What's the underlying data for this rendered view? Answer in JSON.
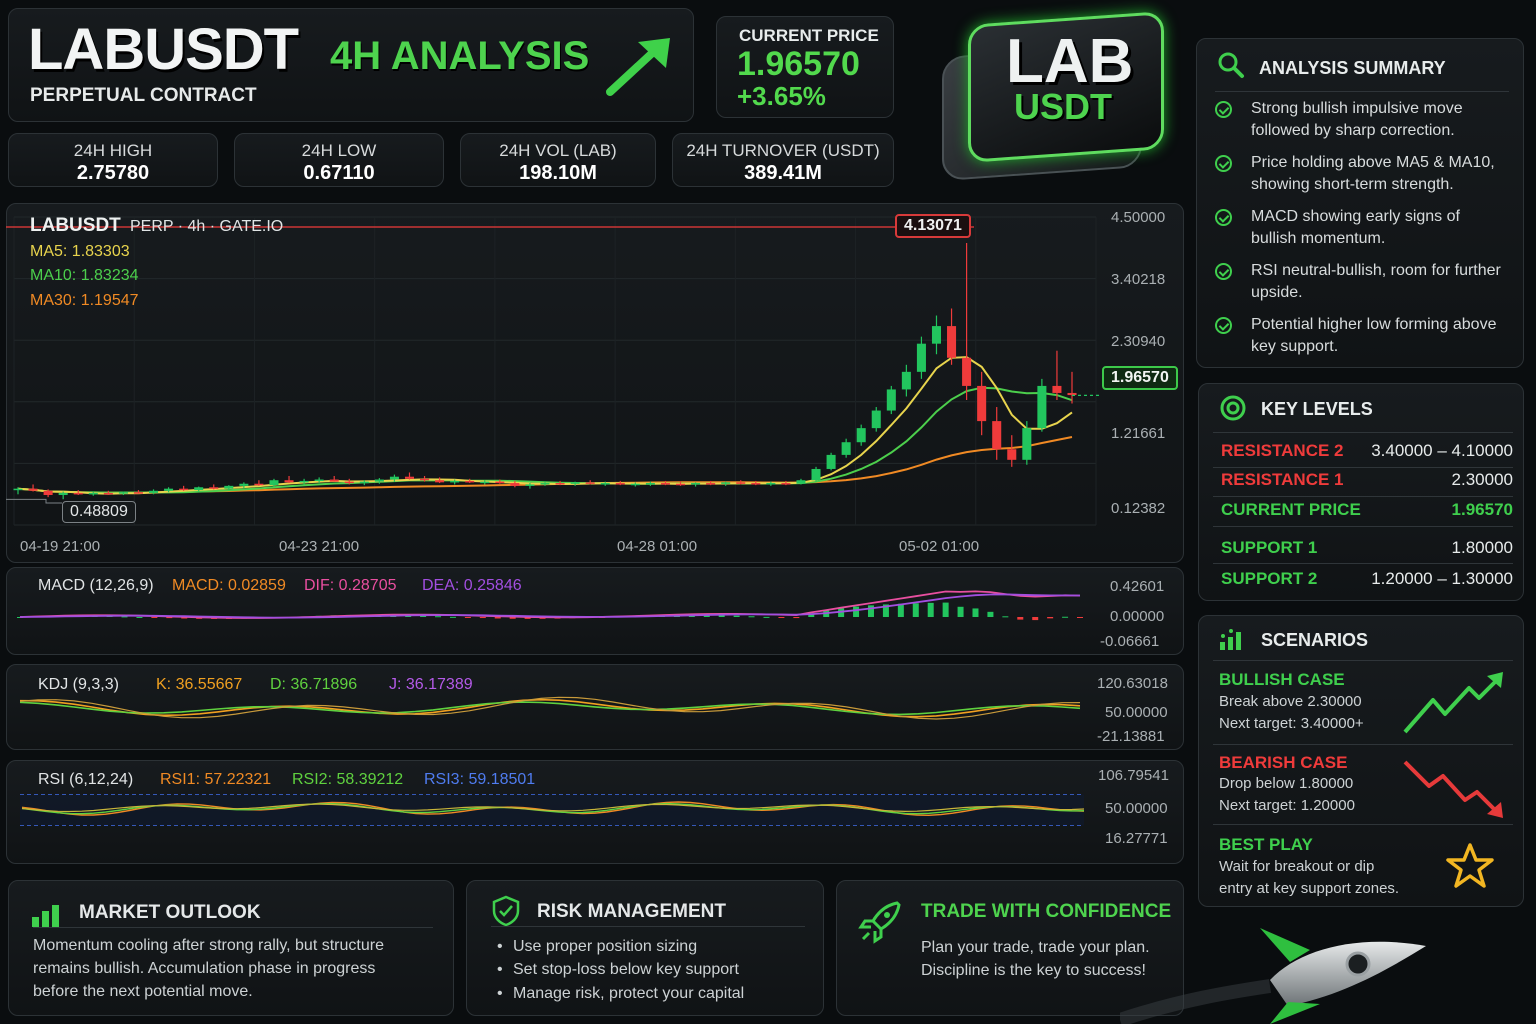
{
  "header": {
    "symbol": "LABUSDT",
    "analysis": "4H ANALYSIS",
    "subtitle": "PERPETUAL CONTRACT",
    "current_price_label": "CURRENT PRICE",
    "current_price": "1.96570",
    "change": "+3.65%",
    "badge_top": "LAB",
    "badge_bottom": "USDT"
  },
  "stats": [
    {
      "label": "24H HIGH",
      "value": "2.75780"
    },
    {
      "label": "24H LOW",
      "value": "0.67110"
    },
    {
      "label": "24H VOL (LAB)",
      "value": "198.10M"
    },
    {
      "label": "24H TURNOVER (USDT)",
      "value": "389.41M"
    }
  ],
  "colors": {
    "up": "#22c55e",
    "down": "#ef3b3b",
    "ma5": "#e8d44d",
    "ma10": "#4ccf4c",
    "ma30": "#f08a24",
    "accent": "#4ed34e"
  },
  "main_chart": {
    "title_symbol": "LABUSDT",
    "title_rest": "PERP · 4h · GATE.IO",
    "ma5": "MA5: 1.83303",
    "ma10": "MA10: 1.83234",
    "ma30": "MA30: 1.19547",
    "high_tag": "4.13071",
    "low_tag": "0.48809",
    "price_tag": "1.96570",
    "y_ticks": [
      "4.50000",
      "3.40218",
      "2.30940",
      "1.21661",
      "0.12382"
    ],
    "x_ticks": [
      "04-19 21:00",
      "04-23 21:00",
      "04-28 01:00",
      "05-02 01:00"
    ]
  },
  "macd": {
    "label": "MACD (12,26,9)",
    "macd": "MACD: 0.02859",
    "dif": "DIF: 0.28705",
    "dea": "DEA: 0.25846",
    "y_ticks": [
      "0.42601",
      "0.00000",
      "-0.06661"
    ]
  },
  "kdj": {
    "label": "KDJ (9,3,3)",
    "k": "K: 36.55667",
    "d": "D: 36.71896",
    "j": "J: 36.17389",
    "y_ticks": [
      "120.63018",
      "50.00000",
      "-21.13881"
    ]
  },
  "rsi": {
    "label": "RSI (6,12,24)",
    "rsi1": "RSI1: 57.22321",
    "rsi2": "RSI2: 58.39212",
    "rsi3": "RSI3: 59.18501",
    "y_ticks": [
      "106.79541",
      "50.00000",
      "16.27771"
    ]
  },
  "summary": {
    "title": "ANALYSIS SUMMARY",
    "items": [
      "Strong bullish impulsive move followed by sharp correction.",
      "Price holding above MA5 & MA10, showing short-term strength.",
      "MACD showing early signs of bullish momentum.",
      "RSI neutral-bullish, room for further upside.",
      "Potential higher low forming above key support."
    ]
  },
  "levels": {
    "title": "KEY LEVELS",
    "rows": [
      {
        "name": "RESISTANCE 2",
        "value": "3.40000 – 4.10000"
      },
      {
        "name": "RESISTANCE 1",
        "value": "2.30000"
      },
      {
        "name": "CURRENT PRICE",
        "value": "1.96570"
      },
      {
        "name": "SUPPORT 1",
        "value": "1.80000"
      },
      {
        "name": "SUPPORT 2",
        "value": "1.20000 – 1.30000"
      }
    ]
  },
  "scenarios": {
    "title": "SCENARIOS",
    "bull_title": "BULLISH CASE",
    "bull_l1": "Break above 2.30000",
    "bull_l2": "Next target: 3.40000+",
    "bear_title": "BEARISH CASE",
    "bear_l1": "Drop below 1.80000",
    "bear_l2": "Next target: 1.20000",
    "best_title": "BEST PLAY",
    "best_l1": "Wait for breakout or dip",
    "best_l2": "entry at key support zones."
  },
  "outlook": {
    "title": "MARKET OUTLOOK",
    "l1": "Momentum cooling after strong rally, but structure",
    "l2": "remains bullish. Accumulation phase in progress",
    "l3": "before the next potential move."
  },
  "risk": {
    "title": "RISK MANAGEMENT",
    "items": [
      "Use proper position sizing",
      "Set stop-loss below key support",
      "Manage risk, protect your capital"
    ]
  },
  "confidence": {
    "title": "TRADE WITH CONFIDENCE",
    "l1": "Plan your trade, trade your plan.",
    "l2": "Discipline is the key to success!"
  },
  "chart_data": [
    {
      "type": "candlestick",
      "y_axis_ticks": [
        4.5,
        3.40218,
        2.3094,
        1.21661,
        0.12382
      ],
      "ylim": [
        0.12382,
        4.5
      ],
      "x_ticks": [
        "04-19 21:00",
        "04-23 21:00",
        "04-28 01:00",
        "05-02 01:00"
      ],
      "series": [
        {
          "name": "MA5",
          "last": 1.83303
        },
        {
          "name": "MA10",
          "last": 1.83234
        },
        {
          "name": "MA30",
          "last": 1.19547
        }
      ],
      "annotations": {
        "high": 4.13071,
        "low": 0.48809,
        "current": 1.9657
      },
      "candles_approx": [
        [
          0.62,
          0.66,
          0.56,
          0.64
        ],
        [
          0.64,
          0.7,
          0.6,
          0.61
        ],
        [
          0.61,
          0.63,
          0.52,
          0.55
        ],
        [
          0.55,
          0.6,
          0.49,
          0.58
        ],
        [
          0.58,
          0.62,
          0.55,
          0.56
        ],
        [
          0.56,
          0.6,
          0.54,
          0.58
        ],
        [
          0.58,
          0.61,
          0.55,
          0.57
        ],
        [
          0.57,
          0.6,
          0.55,
          0.59
        ],
        [
          0.59,
          0.62,
          0.57,
          0.58
        ],
        [
          0.58,
          0.63,
          0.56,
          0.61
        ],
        [
          0.61,
          0.66,
          0.59,
          0.64
        ],
        [
          0.64,
          0.68,
          0.61,
          0.62
        ],
        [
          0.62,
          0.67,
          0.6,
          0.66
        ],
        [
          0.66,
          0.7,
          0.63,
          0.64
        ],
        [
          0.64,
          0.69,
          0.62,
          0.68
        ],
        [
          0.68,
          0.73,
          0.65,
          0.71
        ],
        [
          0.71,
          0.76,
          0.68,
          0.69
        ],
        [
          0.69,
          0.78,
          0.67,
          0.76
        ],
        [
          0.76,
          0.82,
          0.72,
          0.73
        ],
        [
          0.73,
          0.78,
          0.7,
          0.75
        ],
        [
          0.75,
          0.8,
          0.72,
          0.77
        ],
        [
          0.77,
          0.82,
          0.74,
          0.74
        ],
        [
          0.74,
          0.78,
          0.7,
          0.72
        ],
        [
          0.72,
          0.76,
          0.69,
          0.74
        ],
        [
          0.74,
          0.79,
          0.71,
          0.77
        ],
        [
          0.77,
          0.84,
          0.74,
          0.81
        ],
        [
          0.81,
          0.87,
          0.77,
          0.78
        ],
        [
          0.78,
          0.82,
          0.74,
          0.76
        ],
        [
          0.76,
          0.8,
          0.72,
          0.73
        ],
        [
          0.73,
          0.77,
          0.7,
          0.75
        ],
        [
          0.75,
          0.78,
          0.72,
          0.73
        ],
        [
          0.73,
          0.76,
          0.7,
          0.74
        ],
        [
          0.74,
          0.77,
          0.71,
          0.72
        ],
        [
          0.72,
          0.75,
          0.66,
          0.68
        ],
        [
          0.68,
          0.72,
          0.64,
          0.7
        ],
        [
          0.7,
          0.74,
          0.68,
          0.72
        ],
        [
          0.72,
          0.75,
          0.69,
          0.71
        ],
        [
          0.71,
          0.74,
          0.68,
          0.73
        ],
        [
          0.73,
          0.76,
          0.7,
          0.71
        ],
        [
          0.71,
          0.74,
          0.68,
          0.72
        ],
        [
          0.72,
          0.75,
          0.69,
          0.7
        ],
        [
          0.7,
          0.73,
          0.67,
          0.71
        ],
        [
          0.71,
          0.74,
          0.68,
          0.72
        ],
        [
          0.72,
          0.75,
          0.69,
          0.71
        ],
        [
          0.71,
          0.74,
          0.68,
          0.7
        ],
        [
          0.7,
          0.73,
          0.67,
          0.72
        ],
        [
          0.72,
          0.75,
          0.69,
          0.71
        ],
        [
          0.71,
          0.74,
          0.68,
          0.73
        ],
        [
          0.73,
          0.76,
          0.7,
          0.72
        ],
        [
          0.72,
          0.75,
          0.69,
          0.71
        ],
        [
          0.71,
          0.74,
          0.68,
          0.72
        ],
        [
          0.72,
          0.75,
          0.69,
          0.71
        ],
        [
          0.71,
          0.78,
          0.7,
          0.76
        ],
        [
          0.76,
          0.95,
          0.74,
          0.92
        ],
        [
          0.92,
          1.15,
          0.9,
          1.12
        ],
        [
          1.12,
          1.35,
          1.08,
          1.3
        ],
        [
          1.3,
          1.55,
          1.25,
          1.5
        ],
        [
          1.5,
          1.8,
          1.45,
          1.75
        ],
        [
          1.75,
          2.1,
          1.7,
          2.05
        ],
        [
          2.05,
          2.4,
          1.95,
          2.3
        ],
        [
          2.3,
          2.8,
          2.2,
          2.7
        ],
        [
          2.7,
          3.1,
          2.55,
          2.95
        ],
        [
          2.95,
          3.2,
          2.4,
          2.5
        ],
        [
          2.5,
          4.13,
          1.9,
          2.1
        ],
        [
          2.1,
          2.3,
          1.4,
          1.6
        ],
        [
          1.6,
          1.8,
          1.05,
          1.2
        ],
        [
          1.2,
          1.4,
          0.95,
          1.05
        ],
        [
          1.05,
          1.6,
          0.98,
          1.5
        ],
        [
          1.5,
          2.2,
          1.45,
          2.1
        ],
        [
          2.1,
          2.6,
          1.9,
          2.0
        ],
        [
          2.0,
          2.3,
          1.85,
          1.97
        ]
      ]
    },
    {
      "type": "line",
      "title": "MACD (12,26,9)",
      "y_axis_ticks": [
        0.42601,
        0.0,
        -0.06661
      ],
      "series": [
        {
          "name": "DIF",
          "last": 0.28705
        },
        {
          "name": "DEA",
          "last": 0.25846
        },
        {
          "name": "MACD",
          "last": 0.02859
        }
      ]
    },
    {
      "type": "line",
      "title": "KDJ (9,3,3)",
      "y_axis_ticks": [
        120.63018,
        50.0,
        -21.13881
      ],
      "series": [
        {
          "name": "K",
          "last": 36.55667
        },
        {
          "name": "D",
          "last": 36.71896
        },
        {
          "name": "J",
          "last": 36.17389
        }
      ]
    },
    {
      "type": "line",
      "title": "RSI (6,12,24)",
      "y_axis_ticks": [
        106.79541,
        50.0,
        16.27771
      ],
      "series": [
        {
          "name": "RSI1",
          "last": 57.22321
        },
        {
          "name": "RSI2",
          "last": 58.39212
        },
        {
          "name": "RSI3",
          "last": 59.18501
        }
      ]
    }
  ]
}
